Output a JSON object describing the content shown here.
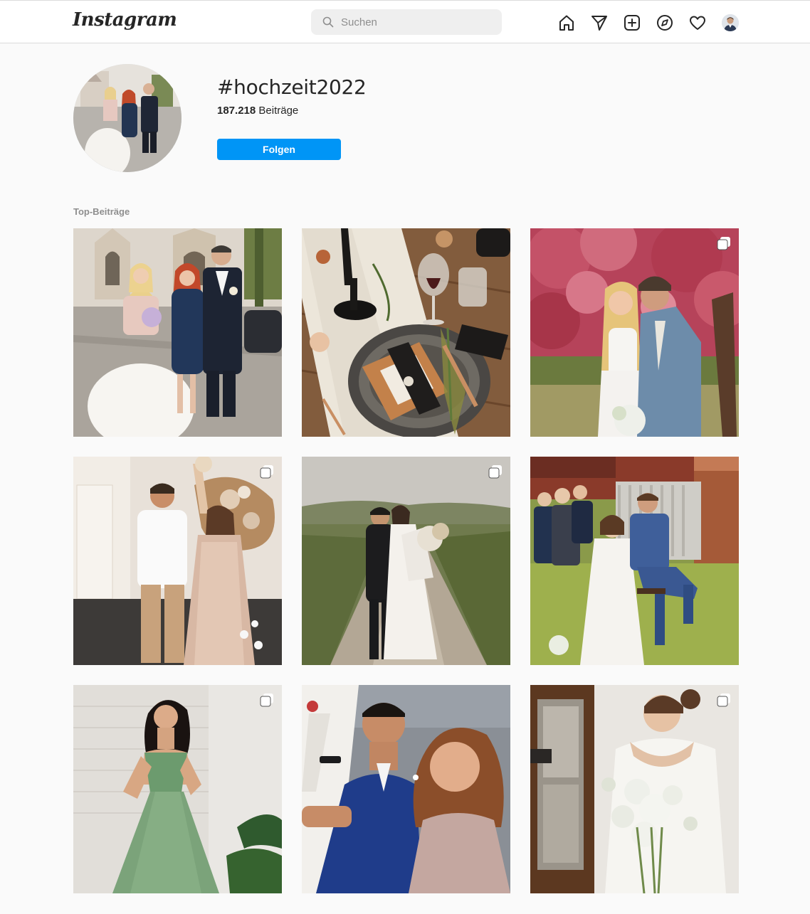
{
  "nav": {
    "logo": "Instagram",
    "search_placeholder": "Suchen",
    "icons": [
      "home-icon",
      "direct-message-icon",
      "new-post-icon",
      "explore-icon",
      "activity-heart-icon"
    ]
  },
  "header": {
    "hashtag": "#hochzeit2022",
    "post_count": "187.218",
    "post_count_label": "Beiträge",
    "follow_label": "Folgen",
    "accent_color": "#0095f6"
  },
  "top_posts": {
    "label": "Top-Beiträge",
    "items": [
      {
        "subject": "bride-groom-guest-photo",
        "multi": false
      },
      {
        "subject": "table-setting-photo",
        "multi": false
      },
      {
        "subject": "couple-blossom-tree-photo",
        "multi": true
      },
      {
        "subject": "couple-dancing-photo",
        "multi": true
      },
      {
        "subject": "couple-vineyard-path-photo",
        "multi": true
      },
      {
        "subject": "outdoor-ceremony-photo",
        "multi": false
      },
      {
        "subject": "green-dress-photo",
        "multi": true
      },
      {
        "subject": "party-selfie-photo",
        "multi": false
      },
      {
        "subject": "bride-bouquet-photo",
        "multi": true
      }
    ]
  }
}
